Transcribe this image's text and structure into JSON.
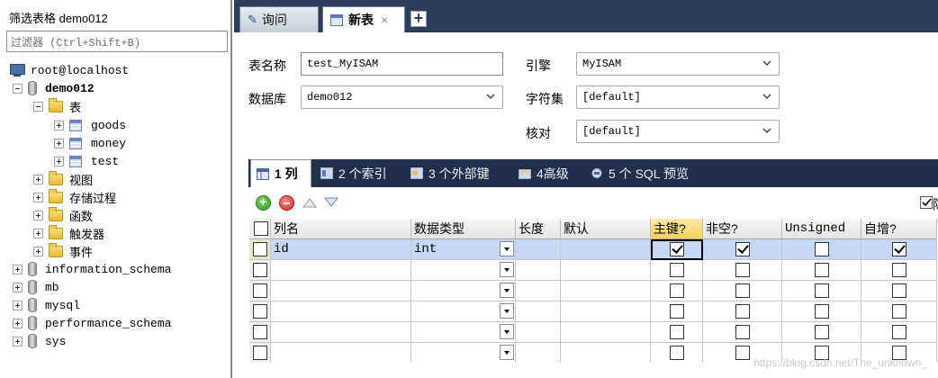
{
  "left_panel": {
    "filter_label": "筛选表格 demo012",
    "filter_placeholder": "过滤器 (Ctrl+Shift+B)",
    "tree": {
      "server": "root@localhost",
      "active_db": "demo012",
      "folder_tables": "表",
      "tables": [
        "goods",
        "money",
        "test"
      ],
      "folders": [
        "视图",
        "存储过程",
        "函数",
        "触发器",
        "事件"
      ],
      "other_dbs": [
        "information_schema",
        "mb",
        "mysql",
        "performance_schema",
        "sys"
      ]
    }
  },
  "tabs": {
    "query": "询问",
    "new_table": "新表",
    "close": "×",
    "add": "+"
  },
  "form": {
    "table_name_label": "表名称",
    "table_name_value": "test_MyISAM",
    "database_label": "数据库",
    "database_value": "demo012",
    "engine_label": "引擎",
    "engine_value": "MyISAM",
    "charset_label": "字符集",
    "charset_value": "[default]",
    "collation_label": "核对",
    "collation_value": "[default]"
  },
  "subtabs": {
    "columns": "1 列",
    "indexes": "2 个索引",
    "foreign_keys": "3 个外部键",
    "advanced": "4高级",
    "sql_preview": "5 个 SQL 预览"
  },
  "grid": {
    "headers": {
      "name": "列名",
      "type": "数据类型",
      "length": "长度",
      "default": "默认",
      "pk": "主键?",
      "not_null": "非空?",
      "unsigned": "Unsigned",
      "auto_inc": "自增?"
    },
    "rows": [
      {
        "name": "id",
        "type": "int",
        "pk": true,
        "not_null": true,
        "unsigned": false,
        "auto_inc": true
      },
      {
        "name": "",
        "type": "",
        "pk": false,
        "not_null": false,
        "unsigned": false,
        "auto_inc": false
      },
      {
        "name": "",
        "type": "",
        "pk": false,
        "not_null": false,
        "unsigned": false,
        "auto_inc": false
      },
      {
        "name": "",
        "type": "",
        "pk": false,
        "not_null": false,
        "unsigned": false,
        "auto_inc": false
      },
      {
        "name": "",
        "type": "",
        "pk": false,
        "not_null": false,
        "unsigned": false,
        "auto_inc": false
      },
      {
        "name": "",
        "type": "",
        "pk": false,
        "not_null": false,
        "unsigned": false,
        "auto_inc": false
      }
    ]
  },
  "toolbar": {
    "hide_label": "隐"
  },
  "watermark": "https://blog.csdn.net/The_unknown_",
  "colors": {
    "tab_bar": "#2c3e5e",
    "subtab_bar": "#1f2f4c",
    "selected_row": "#c5d9f7",
    "pk_header": "#f5cf5a"
  }
}
